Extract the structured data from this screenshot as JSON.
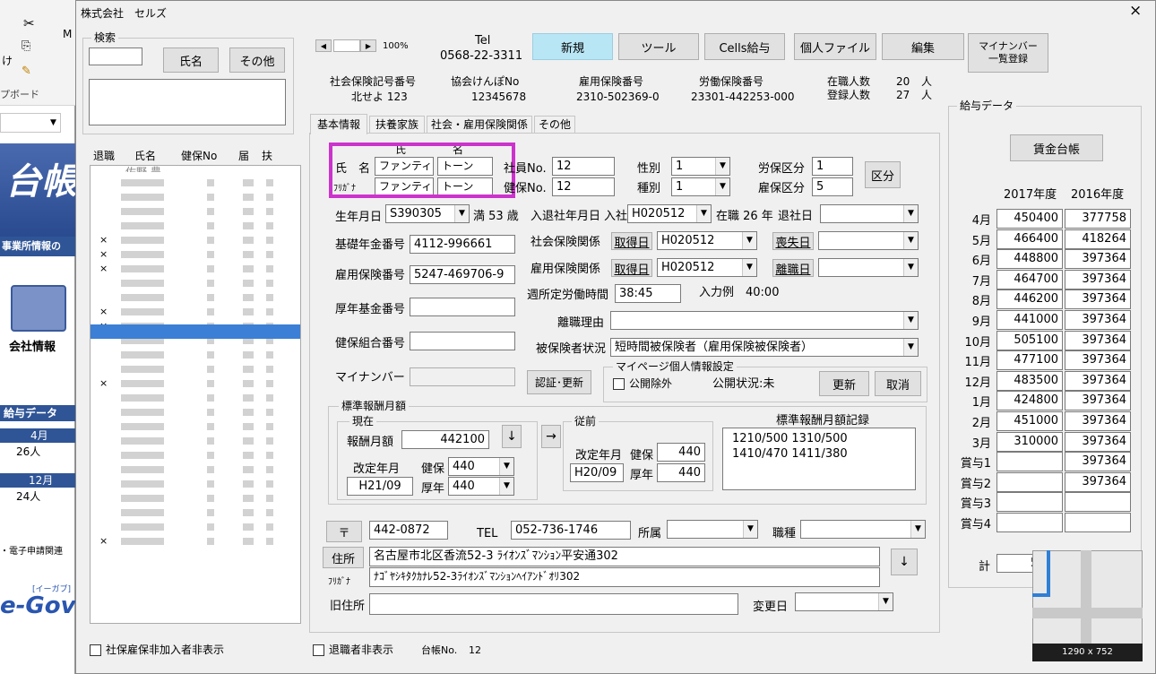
{
  "excel": {
    "ribbon_text1": "け",
    "ribbon_text2": "プボード",
    "ribbon_text3": "M",
    "logo_text": "台帳",
    "banner_text": "事業所情報の",
    "company_label": "会社情報",
    "salary_header": "給与データ",
    "month1": "4月",
    "count1": "26人",
    "month2": "12月",
    "count2": "24人",
    "efile_text": "・電子申請関連",
    "egov_text": "e-Gov",
    "egov_sub": "[イーガブ]"
  },
  "window": {
    "title": "株式会社　セルズ",
    "close": "×"
  },
  "search": {
    "title": "検索",
    "name_btn": "氏名",
    "other_btn": "その他"
  },
  "list": {
    "headers": [
      "退職",
      "氏名",
      "健保No",
      "届",
      "扶"
    ],
    "first_name": "佐野 豊",
    "retired_marks": [
      "",
      "",
      "",
      "",
      "×",
      "×",
      "×",
      "",
      "",
      "×",
      "×",
      "",
      "",
      "",
      "×",
      "",
      "",
      "",
      "",
      "",
      "",
      "",
      "",
      "",
      "",
      "×"
    ]
  },
  "toolbar": {
    "zoom": "100%",
    "tel_label": "Tel",
    "tel": "0568-22-3311",
    "new_btn": "新規",
    "tool_btn": "ツール",
    "cells_btn": "Cells給与",
    "file_btn": "個人ファイル",
    "edit_btn": "編集",
    "mynumber_btn1": "マイナンバー",
    "mynumber_btn2": "一覧登録"
  },
  "insurance": {
    "shaho_label": "社会保険記号番号",
    "shaho": "北せよ 123",
    "kyokai_label": "協会けんぽNo",
    "kyokai": "12345678",
    "koyo_label": "雇用保険番号",
    "koyo": "2310-502369-0",
    "rodo_label": "労働保険番号",
    "rodo": "23301-442253-000",
    "zaishoku_label": "在職人数",
    "zaishoku": "20",
    "toroku_label": "登録人数",
    "toroku": "27",
    "unit": "人"
  },
  "tabs": [
    "基本情報",
    "扶養家族",
    "社会・雇用保険関係",
    "その他"
  ],
  "basic": {
    "sei_header": "氏",
    "mei_header": "名",
    "name_label": "氏　名",
    "kana_label": "ﾌﾘｶﾞﾅ",
    "sei": "ファンティ",
    "mei": "トーン",
    "sei_kana": "ファンティ",
    "mei_kana": "トーン",
    "shain_label": "社員No.",
    "shain": "12",
    "kenpo_label": "健保No.",
    "kenpo": "12",
    "sex_label": "性別",
    "sex": "1",
    "type_label": "種別",
    "type": "1",
    "rouho_label": "労保区分",
    "rouho": "1",
    "koyoho_label": "雇保区分",
    "koyoho": "5",
    "kubun_btn": "区分",
    "birth_label": "生年月日",
    "birth": "S390305",
    "age": "満 53 歳",
    "join_label": "入退社年月日",
    "join_sub": "入社",
    "join": "H020512",
    "tenure": "在職 26 年",
    "leave_label": "退社日",
    "leave": "",
    "pension_label": "基礎年金番号",
    "pension": "4112-996661",
    "shakai_label": "社会保険関係",
    "get_btn": "取得日",
    "shakai_get": "H020512",
    "lose_btn": "喪失日",
    "shakai_lose": "",
    "koyo_label": "雇用保険番号",
    "koyo": "5247-469706-9",
    "koyo_rel_label": "雇用保険関係",
    "koyo_get": "H020512",
    "ridatsu_btn": "離職日",
    "koyo_lose": "",
    "weekly_label": "週所定労働時間",
    "weekly": "38:45",
    "example": "入力例　40:00",
    "kikin_label": "厚年基金番号",
    "kikin": "",
    "reason_label": "離職理由",
    "reason": "",
    "kumiai_label": "健保組合番号",
    "kumiai": "",
    "status_label": "被保険者状況",
    "status": "短時間被保険者（雇用保険被保険者）",
    "mynumber_label": "マイナンバー",
    "auth_btn": "認証･更新",
    "mypage_title": "マイページ個人情報設定",
    "public_label": "公開除外",
    "public_status": "公開状況:未",
    "update_btn": "更新",
    "cancel_btn": "取消"
  },
  "std": {
    "title": "標準報酬月額",
    "current": "現在",
    "monthly_label": "報酬月額",
    "monthly": "442100",
    "kaitei_label": "改定年月",
    "kaitei": "H21/09",
    "kenpo_label": "健保",
    "kenpo": "440",
    "kounen_label": "厚年",
    "kounen": "440",
    "prev": "従前",
    "prev_kaitei_label": "改定年月",
    "prev_kaitei": "H20/09",
    "prev_kenpo_label": "健保",
    "prev_kenpo": "440",
    "prev_kounen_label": "厚年",
    "prev_kounen": "440",
    "record_label": "標準報酬月額記録",
    "record": "1210/500 1310/500 1410/470 1411/380",
    "down": "↓",
    "right": "→"
  },
  "address": {
    "zip_btn": "〒",
    "zip": "442-0872",
    "tel_label": "TEL",
    "tel": "052-736-1746",
    "dept_label": "所属",
    "dept": "",
    "job_label": "職種",
    "job": "",
    "addr_btn": "住所",
    "kana_label": "ﾌﾘｶﾞﾅ",
    "addr": "名古屋市北区香流52-3 ﾗｲｵﾝｽﾞﾏﾝｼｮﾝ平安通302",
    "addr_kana": "ﾅｺﾞﾔｼｷﾀｸｶﾅﾚ52-3ﾗｲｵﾝｽﾞﾏﾝｼｮﾝﾍｲｱﾝﾄﾞｵﾘ302",
    "down_btn": "↓",
    "old_label": "旧住所",
    "old": "",
    "change_label": "変更日",
    "change": ""
  },
  "salary": {
    "title": "給与データ",
    "ledger_btn": "賃金台帳",
    "year1": "2017年度",
    "year2": "2016年度",
    "rows": [
      {
        "m": "4月",
        "a": "450400",
        "b": "377758"
      },
      {
        "m": "5月",
        "a": "466400",
        "b": "418264"
      },
      {
        "m": "6月",
        "a": "448800",
        "b": "397364"
      },
      {
        "m": "7月",
        "a": "464700",
        "b": "397364"
      },
      {
        "m": "8月",
        "a": "446200",
        "b": "397364"
      },
      {
        "m": "9月",
        "a": "441000",
        "b": "397364"
      },
      {
        "m": "10月",
        "a": "505100",
        "b": "397364"
      },
      {
        "m": "11月",
        "a": "477100",
        "b": "397364"
      },
      {
        "m": "12月",
        "a": "483500",
        "b": "397364"
      },
      {
        "m": "1月",
        "a": "424800",
        "b": "397364"
      },
      {
        "m": "2月",
        "a": "451000",
        "b": "397364"
      },
      {
        "m": "3月",
        "a": "310000",
        "b": "397364"
      },
      {
        "m": "賞与1",
        "a": "",
        "b": "397364"
      },
      {
        "m": "賞与2",
        "a": "",
        "b": "397364"
      },
      {
        "m": "賞与3",
        "a": "",
        "b": ""
      },
      {
        "m": "賞与4",
        "a": "",
        "b": ""
      }
    ],
    "total_label": "計",
    "total": "5369"
  },
  "footer": {
    "shaho_hide": "社保雇保非加入者非表示",
    "retired_hide": "退職者非表示",
    "ledger_label": "台帳No.",
    "ledger": "12"
  },
  "thumbnail": {
    "size": "1290 x 752"
  }
}
